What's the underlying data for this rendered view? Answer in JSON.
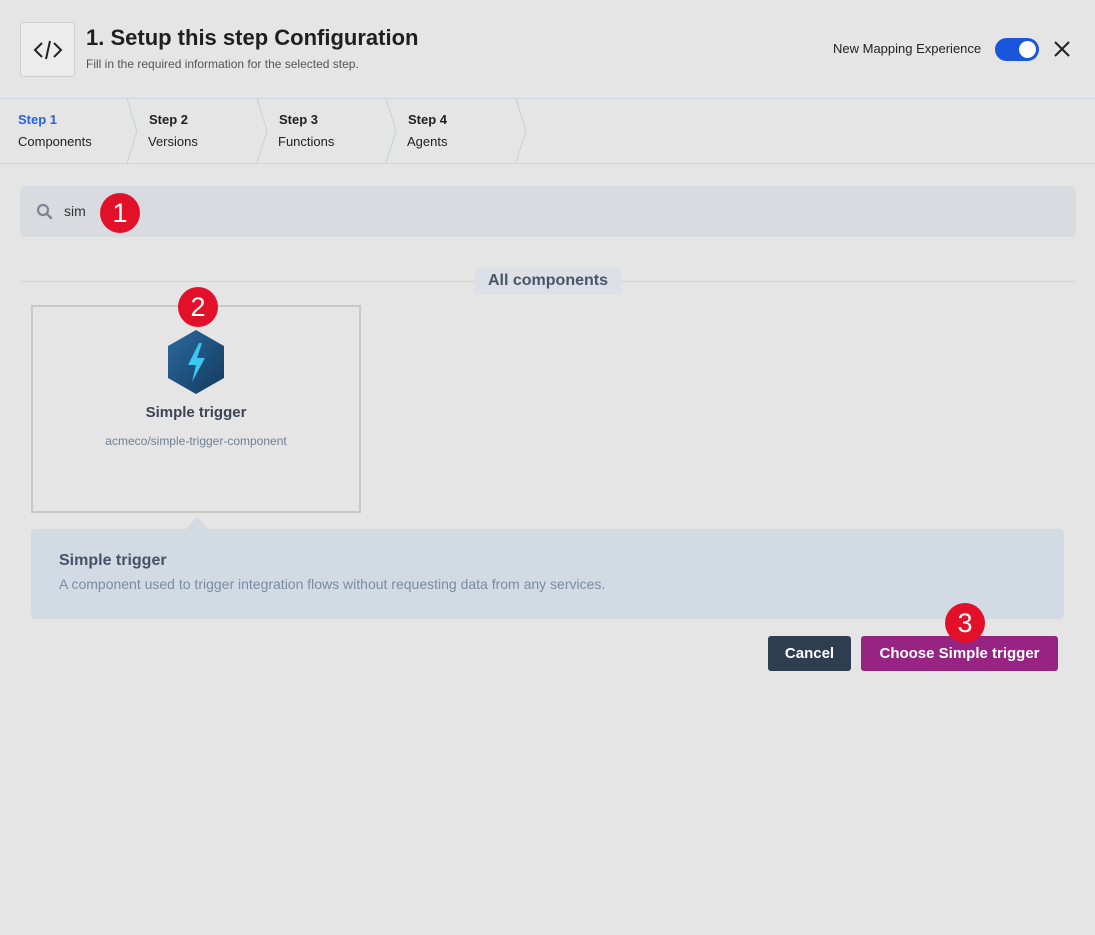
{
  "header": {
    "icon": "code-icon",
    "title": "1. Setup this step Configuration",
    "subtitle": "Fill in the required information for the selected step.",
    "toggle_label": "New Mapping Experience",
    "toggle_on": true,
    "close_icon": "close-icon"
  },
  "steps": [
    {
      "num": "Step 1",
      "name": "Components",
      "active": true
    },
    {
      "num": "Step 2",
      "name": "Versions",
      "active": false
    },
    {
      "num": "Step 3",
      "name": "Functions",
      "active": false
    },
    {
      "num": "Step 4",
      "name": "Agents",
      "active": false
    }
  ],
  "search": {
    "value": "sim",
    "icon": "search-icon"
  },
  "section_label": "All components",
  "component": {
    "title": "Simple trigger",
    "path": "acmeco/simple-trigger-component",
    "icon": "lightning-hexagon-icon"
  },
  "description": {
    "title": "Simple trigger",
    "text": "A component used to trigger integration flows without requesting data from any services."
  },
  "actions": {
    "cancel": "Cancel",
    "choose": "Choose Simple trigger"
  },
  "annotations": [
    "1",
    "2",
    "3"
  ],
  "colors": {
    "accent_blue": "#1a56db",
    "active_step": "#2563eb",
    "primary_button": "#972382",
    "cancel_button": "#2e3d50",
    "badge": "#e3102a"
  }
}
